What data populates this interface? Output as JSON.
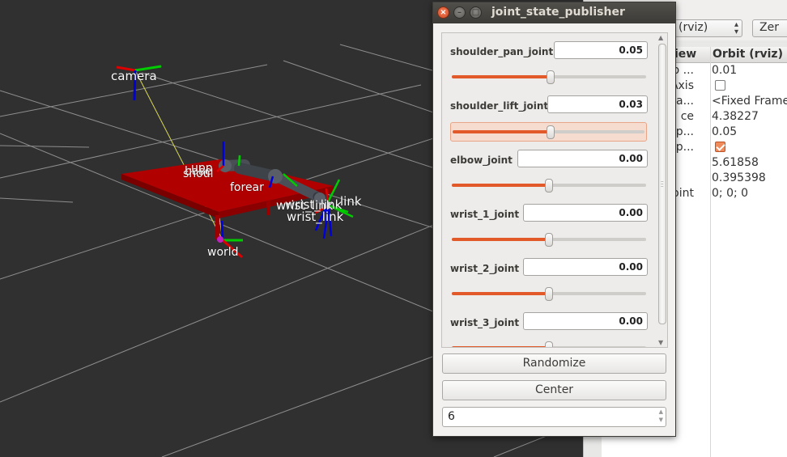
{
  "viewport": {
    "frame_labels": {
      "camera": "camera",
      "world": "world",
      "base": "base",
      "upper": "upp",
      "shoulder": "shoul",
      "forearm": "forear",
      "wrist_link_1": "wrist_link",
      "wrist_link_2": "wrist_link",
      "wrist_link_3": "wrist_link",
      "link": "link"
    }
  },
  "jsp": {
    "title": "joint_state_publisher",
    "close_glyph": "×",
    "minimize_glyph": "–",
    "maximize_glyph": "□",
    "joints": [
      {
        "name": "shoulder_pan_joint",
        "value": "0.05",
        "fraction": 0.51
      },
      {
        "name": "shoulder_lift_joint",
        "value": "0.03",
        "fraction": 0.505
      },
      {
        "name": "elbow_joint",
        "value": "0.00",
        "fraction": 0.5
      },
      {
        "name": "wrist_1_joint",
        "value": "0.00",
        "fraction": 0.5
      },
      {
        "name": "wrist_2_joint",
        "value": "0.00",
        "fraction": 0.5
      },
      {
        "name": "wrist_3_joint",
        "value": "0.00",
        "fraction": 0.5
      }
    ],
    "randomize_label": "Randomize",
    "center_label": "Center",
    "spin_value": "6"
  },
  "rviz": {
    "view_type": "(rviz)",
    "zero_label": "Zer",
    "header_name": "iew",
    "header_value": "Orbit (rviz)",
    "properties": [
      {
        "key": "ip ...",
        "value": "0.01"
      },
      {
        "key": "Z Axis",
        "value": "",
        "checkbox": false
      },
      {
        "key": "Fra...",
        "value": "<Fixed Frame>"
      },
      {
        "key": "ce",
        "value": "4.38227"
      },
      {
        "key": "hap...",
        "value": "0.05"
      },
      {
        "key": "hap...",
        "value": "",
        "checkbox": true
      },
      {
        "key": "",
        "value": "5.61858"
      },
      {
        "key": "",
        "value": "0.395398"
      },
      {
        "key": "oint",
        "value": "0; 0; 0"
      }
    ]
  },
  "colors": {
    "slider_fill": "#e2592a",
    "titlebar": "#3c3b37",
    "table_red": "#b00000"
  }
}
